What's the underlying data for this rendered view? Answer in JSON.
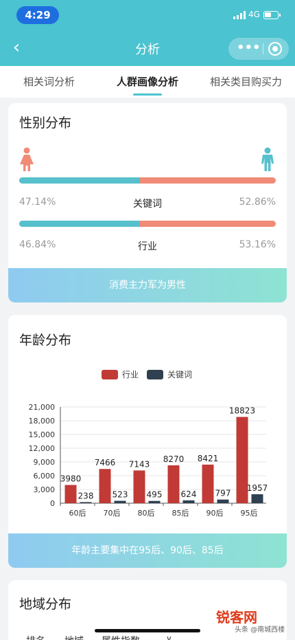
{
  "status_bar": {
    "time": "4:29",
    "network": "4G"
  },
  "nav": {
    "title": "分析"
  },
  "tabs": [
    {
      "label": "相关词分析",
      "active": false
    },
    {
      "label": "人群画像分析",
      "active": true
    },
    {
      "label": "相关类目购买力",
      "active": false
    }
  ],
  "gender": {
    "title": "性别分布",
    "female_icon": "female-figure-icon",
    "male_icon": "male-figure-icon",
    "rows": [
      {
        "label": "关键词",
        "left": "47.14%",
        "right": "52.86%",
        "left_value": 47.14
      },
      {
        "label": "行业",
        "left": "46.84%",
        "right": "53.16%",
        "left_value": 46.84
      }
    ],
    "banner": "消费主力军为男性",
    "colors": {
      "female": "#f08b77",
      "male": "#56c0cc"
    }
  },
  "age": {
    "title": "年龄分布",
    "banner": "年龄主要集中在95后、90后、85后",
    "legend": [
      "行业",
      "关键词"
    ],
    "colors": {
      "industry": "#c13a35",
      "keyword": "#2f4050"
    }
  },
  "chart_data": {
    "type": "bar",
    "categories": [
      "60后",
      "70后",
      "80后",
      "85后",
      "90后",
      "95后"
    ],
    "series": [
      {
        "name": "行业",
        "values": [
          3980,
          7466,
          7143,
          8270,
          8421,
          18823
        ]
      },
      {
        "name": "关键词",
        "values": [
          238,
          523,
          495,
          624,
          797,
          1957
        ]
      }
    ],
    "yticks": [
      "0",
      "3,000",
      "6,000",
      "9,000",
      "12,000",
      "15,000",
      "18,000",
      "21,000"
    ],
    "ylim": [
      0,
      21000
    ],
    "legend": "top-center",
    "grid": true
  },
  "region": {
    "title": "地域分布",
    "headers": [
      "排名",
      "地域",
      "属性指数"
    ]
  },
  "watermark": {
    "logo": "锐客网",
    "text": "头条 @南城西楼"
  }
}
